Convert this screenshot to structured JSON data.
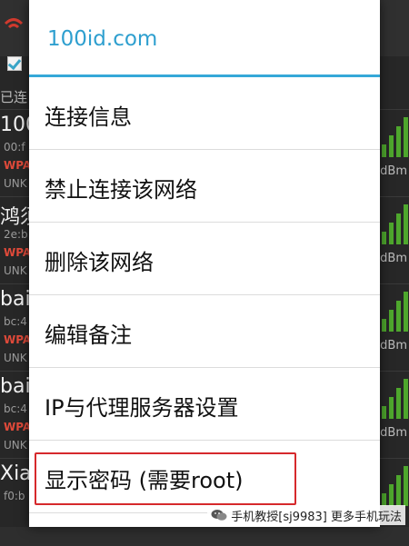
{
  "background": {
    "connected_label": "已连",
    "networks": [
      {
        "name": "100",
        "mac": "00:f",
        "security": "WPA",
        "status": "UNK",
        "signal": "dBm"
      },
      {
        "name": "鸿须",
        "mac": "2e:b",
        "security": "WPA",
        "status": "UNK",
        "signal": "dBm"
      },
      {
        "name": "bai",
        "mac": "bc:4",
        "security": "WPA",
        "status": "UNK",
        "signal": "dBm"
      },
      {
        "name": "bai",
        "mac": "bc:4",
        "security": "WPA",
        "status": "UNK",
        "signal": "dBm"
      },
      {
        "name": "Xia",
        "mac": "f0:b",
        "security": "",
        "status": "",
        "signal": ""
      }
    ]
  },
  "dialog": {
    "title": "100id.com",
    "items": [
      {
        "label": "连接信息"
      },
      {
        "label": "禁止连接该网络"
      },
      {
        "label": "删除该网络"
      },
      {
        "label": "编辑备注"
      },
      {
        "label": "IP与代理服务器设置"
      },
      {
        "label": "显示密码 (需要root)"
      }
    ],
    "highlight_color": "#d6292c",
    "accent_color": "#35a8d8"
  },
  "watermark": {
    "text": "手机教授[sj9983] 更多手机玩法"
  }
}
